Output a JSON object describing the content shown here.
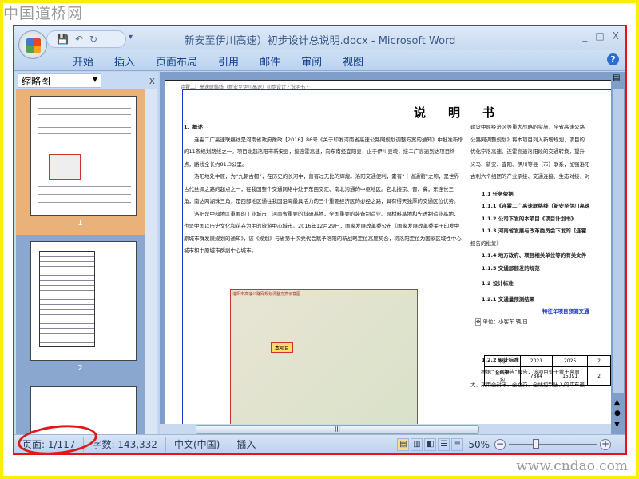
{
  "watermark": {
    "logo": "中国道桥网",
    "site": "www.cndao.com"
  },
  "window": {
    "title": "新安至伊川高速）初步设计总说明.docx - Microsoft Word",
    "controls": [
      "_",
      "□",
      "X"
    ]
  },
  "ribbon": {
    "tabs": [
      "开始",
      "插入",
      "页面布局",
      "引用",
      "邮件",
      "审阅",
      "视图"
    ],
    "help": "?"
  },
  "nav_pane": {
    "selector": "缩略图",
    "close": "x",
    "thumbnails": [
      {
        "label": "1"
      },
      {
        "label": "2"
      }
    ]
  },
  "document": {
    "header": "连霍二广高速联络线（新安至伊川高速）初步设计・说明书・",
    "title": "说明书",
    "heading1": "1、概述",
    "paragraphs": [
      "连霍二广高速联络线是河南省政府豫政【2016】86号《关于印发河南省高速公路网规划调整方案的通知》中批准新增的11条规划路线之一。项目北起洛阳市新安县，接连霍高速，向东南经宜阳县，止于伊川县境，接二广高速到达项目终点，路线全长约81.3公里。",
      "洛阳地处中原，为“九朝古都”，在历史的长河中，曾有过无比的辉煌。洛阳交通便利，素有“十省通衢”之称，是世界古代丝绸之路的起点之一，在我国整个交通网络中处于东西交汇、南北沟通的中枢地区。它北接京、晋、冀，东连长三角，南达两湖珠三角，是西部地区通往我国沿海最具活力的三个重要经济区的必经之路，具有得天独厚的交通区位优势。",
      "洛阳是中部地区重要的工业城市，河南省重要的科研基地，全国重要的装备制造业、原材料基地和先进制造业基地，也是中国以历史文化和花卉为主的旅游中心城市。2016年12月29日，国家发展改革委公布《国家发展改革委关于印发中原城市群发展规划的通知》，该《规划》与省第十次党代会赋予洛阳的新战略定位高度契合，将洛阳定位为国家区域性中心城市和中原城市群副中心城市。"
    ],
    "right_lines": [
      "建设中原经济区等重大战略的实施，全省高速公路",
      "公路网调整规划》将本项目列入新增规划，项目的",
      "优化宁洛高速、连霍高速洛阳段的交通转换，提升",
      "义马、新安、宜阳、伊川等县（市）联系，加强洛阳",
      "古利六个组团的产业承接、交通连接、生态对接，对"
    ],
    "outline": [
      "1.1 任务依据",
      "1.1.1《连霍二广高速联络线（新安至伊川高速",
      "1.1.2 公司下发的本项目《项目计划书》",
      "1.1.3 河南省发展与改革委员会下发的《连霍",
      "报告的批复》",
      "1.1.4 地方政府、项目相关单位等的有关文件",
      "1.1.5 交通部颁发的规范",
      "1.2 设计标准",
      "1.2.1 交通量预测结果",
      "1.2.2 设计标准"
    ],
    "table_title": "特征年项目预测交通",
    "table_unit": "单位：小客车 辆/日",
    "table": [
      [
        "年份",
        "2021",
        "2025",
        "2"
      ],
      [
        "全线平均",
        "7884",
        "15391",
        "2"
      ]
    ],
    "last_lines": [
      "根据“工可报告”报告，该项目处于黄土高原",
      "大，采用全封闭、全立交、全线控制出入的四车道"
    ],
    "map_caption": "洛阳市高速公路网规划调整方案示意图",
    "map_tag": "本项目"
  },
  "status": {
    "page": "页面: 1/117",
    "words": "字数: 143,332",
    "language": "中文(中国)",
    "mode": "插入",
    "zoom": "50%",
    "zoom_out": "−",
    "zoom_in": "+"
  }
}
